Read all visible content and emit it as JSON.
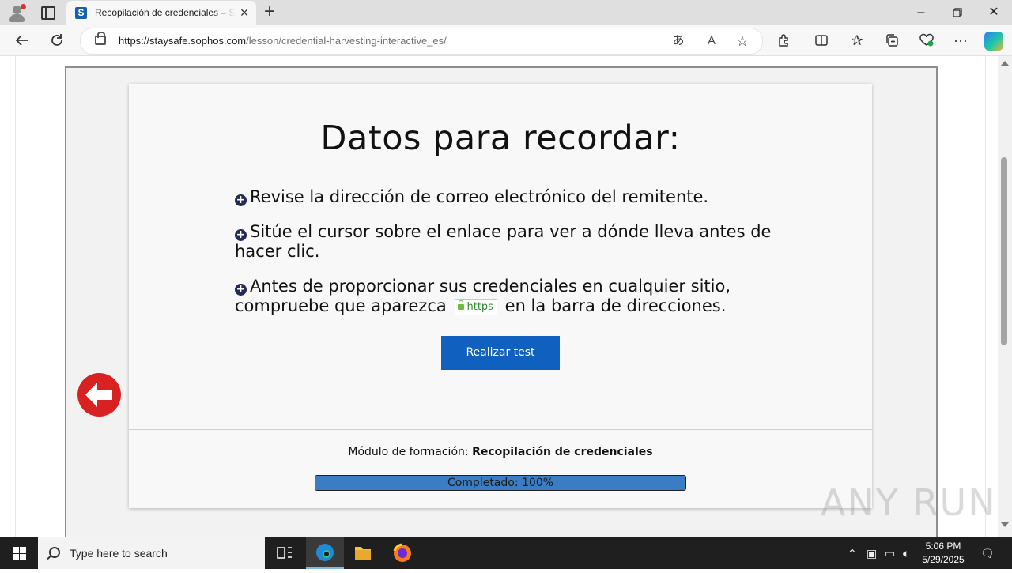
{
  "browser": {
    "tab": {
      "title": "Recopilación de credenciales – Sophos",
      "favicon_letter": "S"
    },
    "new_tab_label": "+",
    "address": {
      "host": "https://staysafe.sophos.com",
      "path": "/lesson/credential-harvesting-interactive_es/"
    },
    "icons": [
      "profile-icon",
      "tab-actions-icon",
      "back-arrow-icon",
      "refresh-icon",
      "lock-icon",
      "read-aloud-icon",
      "immersive-reader-icon",
      "favorite-star-icon",
      "extensions-icon",
      "split-screen-icon",
      "favorites-icon",
      "collections-icon",
      "browser-essentials-icon",
      "more-menu-icon",
      "copilot-icon"
    ]
  },
  "lesson": {
    "heading": "Datos para recordar:",
    "tips": [
      "Revise la dirección de correo electrónico del remitente.",
      "Sitúe el cursor sobre el enlace para ver a dónde lleva antes de hacer clic."
    ],
    "tip3_before": "Antes de proporcionar sus credenciales en cualquier sitio, compruebe que aparezca",
    "tip3_badge": "https",
    "tip3_after": "en la barra de direcciones.",
    "test_button": "Realizar test",
    "module_label": "Módulo de formación:",
    "module_name": "Recopilación de credenciales",
    "progress_text": "Completado: 100%",
    "progress_value": 1.0
  },
  "watermark": "ANY RUN",
  "taskbar": {
    "search_placeholder": "Type here to search",
    "time": "5:06 PM",
    "date": "5/29/2025"
  },
  "colors": {
    "accent": "#1060c0",
    "back_button": "#d82222",
    "progress": "#3b7dc4"
  }
}
